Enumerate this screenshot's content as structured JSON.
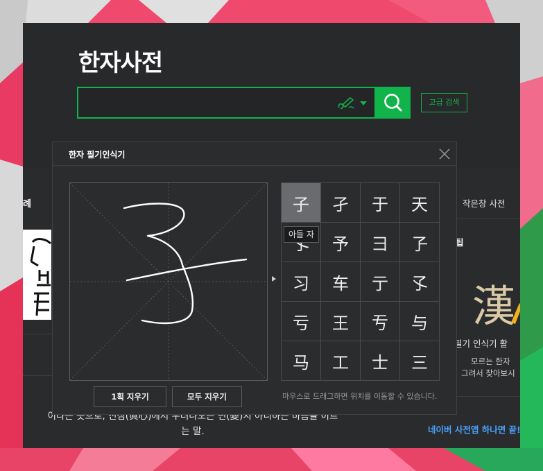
{
  "app": {
    "title": "한자사전"
  },
  "search": {
    "value": "",
    "placeholder": "",
    "pen_icon": "handwriting-pen-icon",
    "search_icon": "magnifier-icon",
    "advanced_label": "고급 검색",
    "accent_color": "#11b44a"
  },
  "left_panel": {
    "label": "례",
    "meaning_line1": "이라는 뜻으로, 진심(眞心)에서 우러나오는 변(變)치 아니하는 마음을 이르",
    "meaning_line2": "는 말."
  },
  "right_panel": {
    "mini_dict_label": "작은창 사전",
    "tip_label": "팁",
    "big_glyph": "漢",
    "caption": "필기 인식기 활",
    "desc1": "모르는 한자",
    "desc2": "그려서 찾아보시",
    "app_link": "네이버 사전앱 하나면 끝!"
  },
  "handwriting": {
    "title": "한자 필기인식기",
    "close_icon": "close-x-icon",
    "erase_one_label": "1획 지우기",
    "erase_all_label": "모두 지우기",
    "drag_hint": "마우스로 드래그하면 위치를 이동할 수 있습니다.",
    "tooltip": "아들 자",
    "selected_index": 0,
    "candidates": [
      "子",
      "孑",
      "于",
      "天",
      "孓",
      "予",
      "彐",
      "孒",
      "习",
      "车",
      "亍",
      "孓",
      "亏",
      "王",
      "亐",
      "与",
      "马",
      "工",
      "士",
      "三"
    ]
  }
}
